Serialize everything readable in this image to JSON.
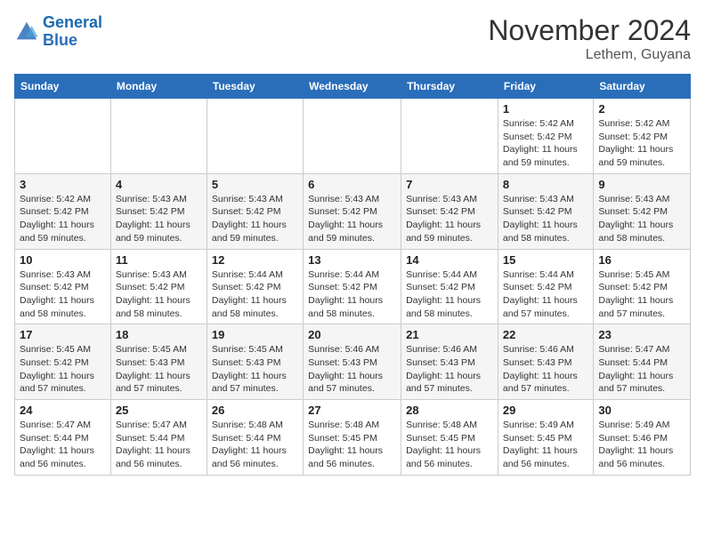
{
  "logo": {
    "line1": "General",
    "line2": "Blue"
  },
  "title": "November 2024",
  "location": "Lethem, Guyana",
  "weekdays": [
    "Sunday",
    "Monday",
    "Tuesday",
    "Wednesday",
    "Thursday",
    "Friday",
    "Saturday"
  ],
  "weeks": [
    [
      {
        "day": "",
        "info": ""
      },
      {
        "day": "",
        "info": ""
      },
      {
        "day": "",
        "info": ""
      },
      {
        "day": "",
        "info": ""
      },
      {
        "day": "",
        "info": ""
      },
      {
        "day": "1",
        "info": "Sunrise: 5:42 AM\nSunset: 5:42 PM\nDaylight: 11 hours and 59 minutes."
      },
      {
        "day": "2",
        "info": "Sunrise: 5:42 AM\nSunset: 5:42 PM\nDaylight: 11 hours and 59 minutes."
      }
    ],
    [
      {
        "day": "3",
        "info": "Sunrise: 5:42 AM\nSunset: 5:42 PM\nDaylight: 11 hours and 59 minutes."
      },
      {
        "day": "4",
        "info": "Sunrise: 5:43 AM\nSunset: 5:42 PM\nDaylight: 11 hours and 59 minutes."
      },
      {
        "day": "5",
        "info": "Sunrise: 5:43 AM\nSunset: 5:42 PM\nDaylight: 11 hours and 59 minutes."
      },
      {
        "day": "6",
        "info": "Sunrise: 5:43 AM\nSunset: 5:42 PM\nDaylight: 11 hours and 59 minutes."
      },
      {
        "day": "7",
        "info": "Sunrise: 5:43 AM\nSunset: 5:42 PM\nDaylight: 11 hours and 59 minutes."
      },
      {
        "day": "8",
        "info": "Sunrise: 5:43 AM\nSunset: 5:42 PM\nDaylight: 11 hours and 58 minutes."
      },
      {
        "day": "9",
        "info": "Sunrise: 5:43 AM\nSunset: 5:42 PM\nDaylight: 11 hours and 58 minutes."
      }
    ],
    [
      {
        "day": "10",
        "info": "Sunrise: 5:43 AM\nSunset: 5:42 PM\nDaylight: 11 hours and 58 minutes."
      },
      {
        "day": "11",
        "info": "Sunrise: 5:43 AM\nSunset: 5:42 PM\nDaylight: 11 hours and 58 minutes."
      },
      {
        "day": "12",
        "info": "Sunrise: 5:44 AM\nSunset: 5:42 PM\nDaylight: 11 hours and 58 minutes."
      },
      {
        "day": "13",
        "info": "Sunrise: 5:44 AM\nSunset: 5:42 PM\nDaylight: 11 hours and 58 minutes."
      },
      {
        "day": "14",
        "info": "Sunrise: 5:44 AM\nSunset: 5:42 PM\nDaylight: 11 hours and 58 minutes."
      },
      {
        "day": "15",
        "info": "Sunrise: 5:44 AM\nSunset: 5:42 PM\nDaylight: 11 hours and 57 minutes."
      },
      {
        "day": "16",
        "info": "Sunrise: 5:45 AM\nSunset: 5:42 PM\nDaylight: 11 hours and 57 minutes."
      }
    ],
    [
      {
        "day": "17",
        "info": "Sunrise: 5:45 AM\nSunset: 5:42 PM\nDaylight: 11 hours and 57 minutes."
      },
      {
        "day": "18",
        "info": "Sunrise: 5:45 AM\nSunset: 5:43 PM\nDaylight: 11 hours and 57 minutes."
      },
      {
        "day": "19",
        "info": "Sunrise: 5:45 AM\nSunset: 5:43 PM\nDaylight: 11 hours and 57 minutes."
      },
      {
        "day": "20",
        "info": "Sunrise: 5:46 AM\nSunset: 5:43 PM\nDaylight: 11 hours and 57 minutes."
      },
      {
        "day": "21",
        "info": "Sunrise: 5:46 AM\nSunset: 5:43 PM\nDaylight: 11 hours and 57 minutes."
      },
      {
        "day": "22",
        "info": "Sunrise: 5:46 AM\nSunset: 5:43 PM\nDaylight: 11 hours and 57 minutes."
      },
      {
        "day": "23",
        "info": "Sunrise: 5:47 AM\nSunset: 5:44 PM\nDaylight: 11 hours and 57 minutes."
      }
    ],
    [
      {
        "day": "24",
        "info": "Sunrise: 5:47 AM\nSunset: 5:44 PM\nDaylight: 11 hours and 56 minutes."
      },
      {
        "day": "25",
        "info": "Sunrise: 5:47 AM\nSunset: 5:44 PM\nDaylight: 11 hours and 56 minutes."
      },
      {
        "day": "26",
        "info": "Sunrise: 5:48 AM\nSunset: 5:44 PM\nDaylight: 11 hours and 56 minutes."
      },
      {
        "day": "27",
        "info": "Sunrise: 5:48 AM\nSunset: 5:45 PM\nDaylight: 11 hours and 56 minutes."
      },
      {
        "day": "28",
        "info": "Sunrise: 5:48 AM\nSunset: 5:45 PM\nDaylight: 11 hours and 56 minutes."
      },
      {
        "day": "29",
        "info": "Sunrise: 5:49 AM\nSunset: 5:45 PM\nDaylight: 11 hours and 56 minutes."
      },
      {
        "day": "30",
        "info": "Sunrise: 5:49 AM\nSunset: 5:46 PM\nDaylight: 11 hours and 56 minutes."
      }
    ]
  ]
}
